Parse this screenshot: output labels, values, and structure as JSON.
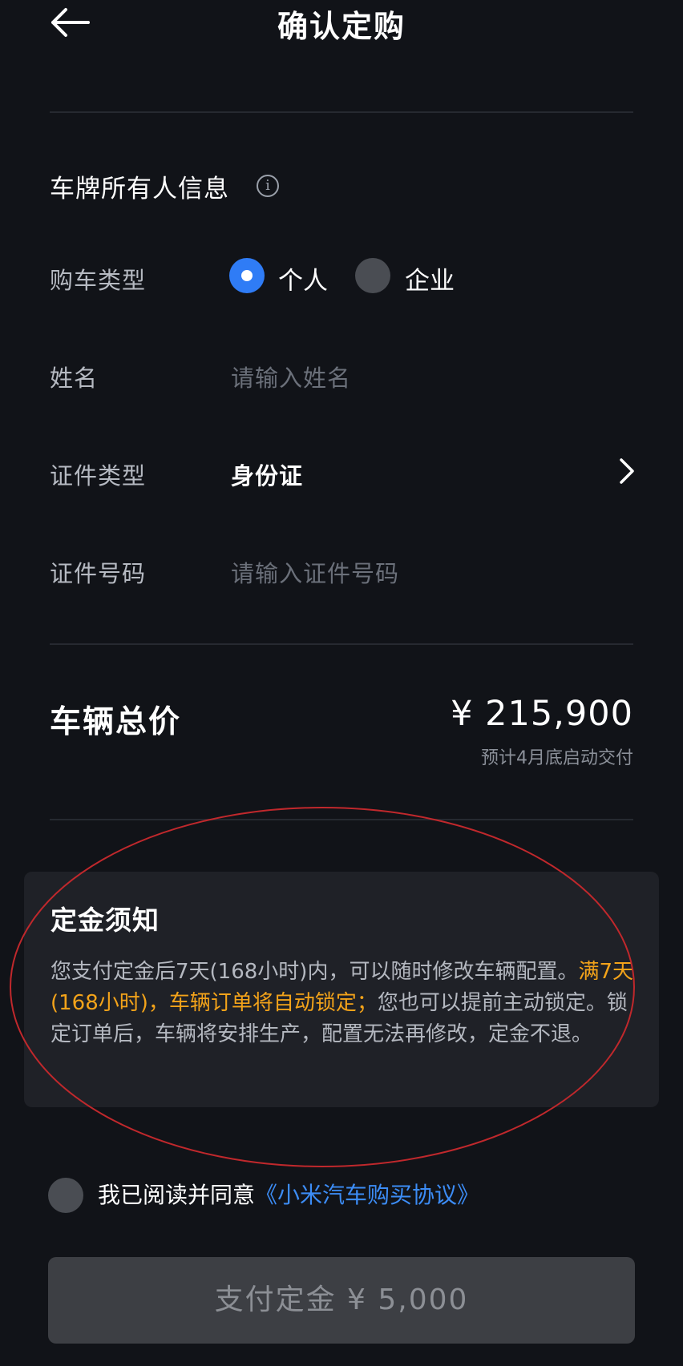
{
  "header": {
    "title": "确认定购",
    "back_icon": "arrow-left-icon"
  },
  "owner_section": {
    "title": "车牌所有人信息",
    "info_icon": "info-icon",
    "info_symbol": "i",
    "purchase_type": {
      "label": "购车类型",
      "options": [
        {
          "label": "个人",
          "selected": true
        },
        {
          "label": "企业",
          "selected": false
        }
      ]
    },
    "name": {
      "label": "姓名",
      "placeholder": "请输入姓名"
    },
    "id_type": {
      "label": "证件类型",
      "value": "身份证"
    },
    "id_number": {
      "label": "证件号码",
      "placeholder": "请输入证件号码"
    }
  },
  "total": {
    "label": "车辆总价",
    "price": "¥ 215,900",
    "note": "预计4月底启动交付"
  },
  "notice": {
    "title": "定金须知",
    "body_part1": "您支付定金后7天(168小时)内，可以随时修改车辆配置。",
    "body_highlight": "满7天(168小时)，车辆订单将自动锁定；",
    "body_part2": "您也可以提前主动锁定。锁定订单后，车辆将安排生产，配置无法再修改，定金不退。"
  },
  "agreement": {
    "prefix": "我已阅读并同意",
    "link": "《小米汽车购买协议》",
    "checked": false
  },
  "pay_button": {
    "label": "支付定金 ¥ 5,000"
  },
  "colors": {
    "background": "#111318",
    "accent": "#2f7cf6",
    "highlight": "#f3a31a",
    "link": "#3c8cf5",
    "annotation": "#c0282c"
  }
}
